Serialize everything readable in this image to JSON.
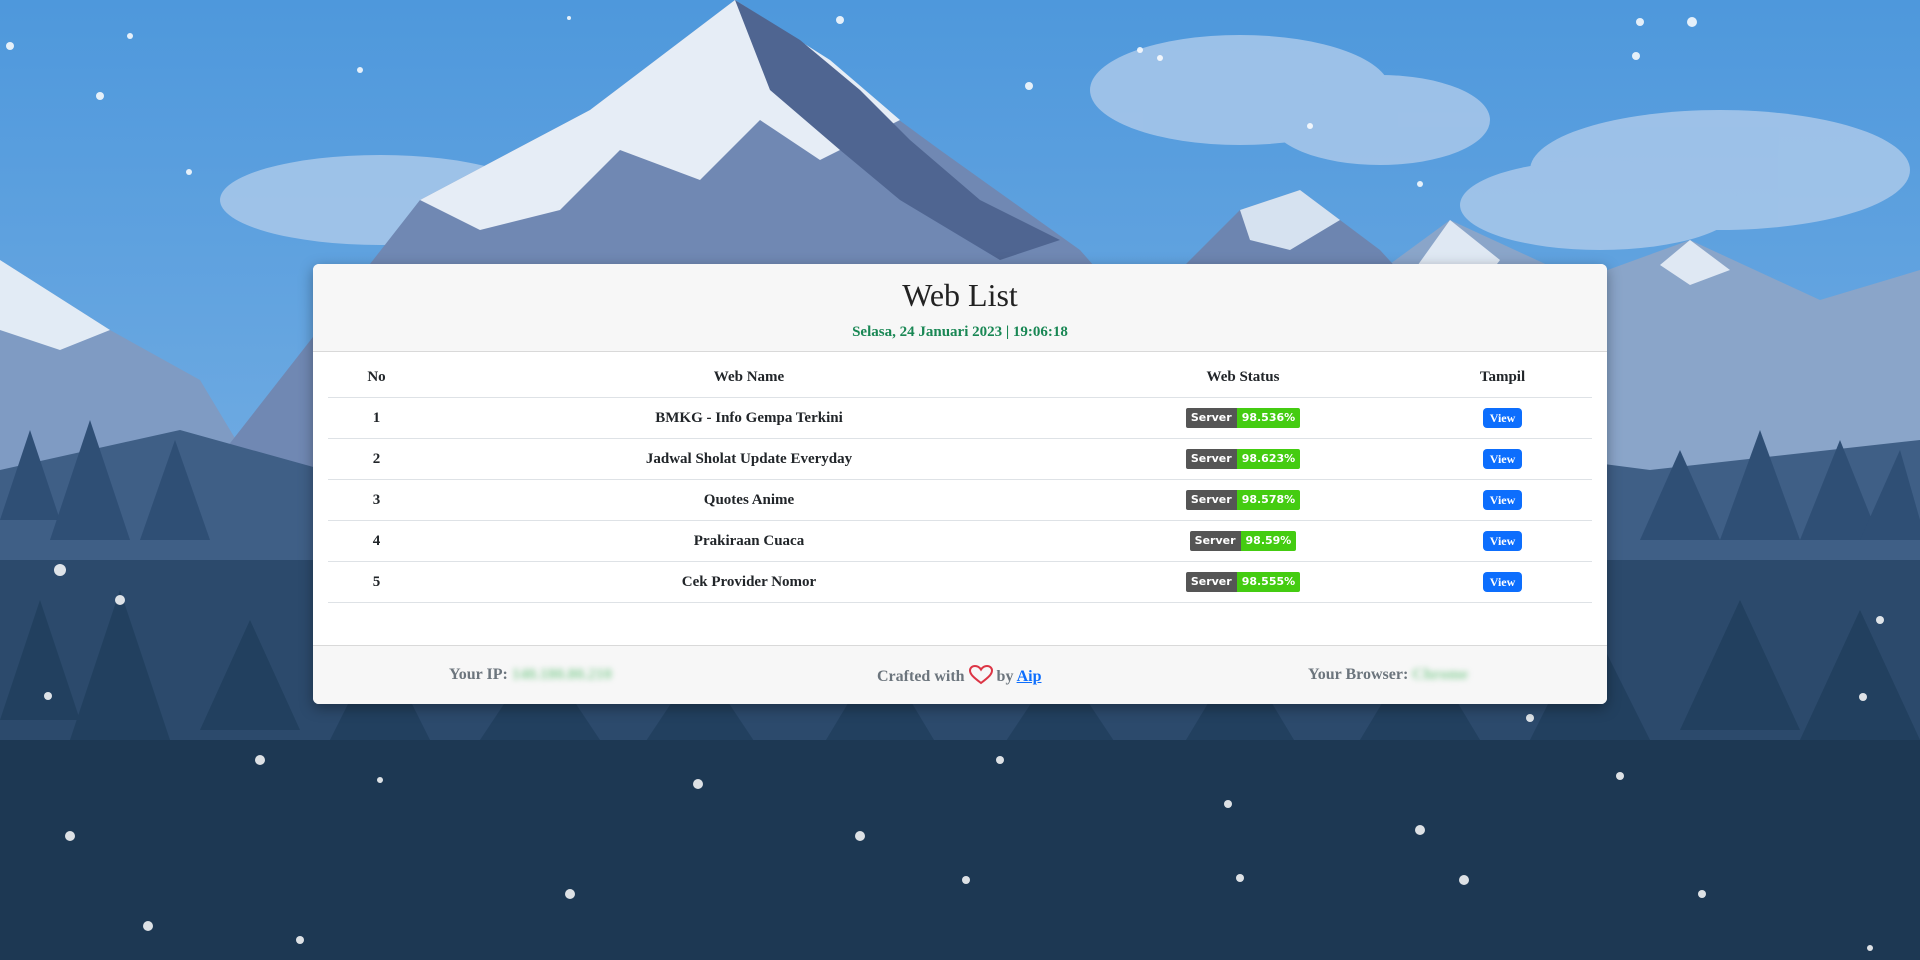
{
  "header": {
    "title": "Web List",
    "datetime": "Selasa, 24 Januari 2023 | 19:06:18"
  },
  "table": {
    "columns": [
      "No",
      "Web Name",
      "Web Status",
      "Tampil"
    ],
    "rows": [
      {
        "no": "1",
        "name": "BMKG - Info Gempa Terkini",
        "status_label": "Server",
        "status_value": "98.536%",
        "action": "View"
      },
      {
        "no": "2",
        "name": "Jadwal Sholat Update Everyday",
        "status_label": "Server",
        "status_value": "98.623%",
        "action": "View"
      },
      {
        "no": "3",
        "name": "Quotes Anime",
        "status_label": "Server",
        "status_value": "98.578%",
        "action": "View"
      },
      {
        "no": "4",
        "name": "Prakiraan Cuaca",
        "status_label": "Server",
        "status_value": "98.59%",
        "action": "View"
      },
      {
        "no": "5",
        "name": "Cek Provider Nomor",
        "status_label": "Server",
        "status_value": "98.555%",
        "action": "View"
      }
    ]
  },
  "footer": {
    "ip_label": "Your IP:",
    "ip_value": "140.180.80.210",
    "credit_prefix": "Crafted with",
    "credit_by": "by",
    "author": "Aip",
    "browser_label": "Your Browser:",
    "browser_value": "Chrome"
  },
  "colors": {
    "accent": "#0d6efd",
    "datetime": "#198754",
    "badge_label": "#555555",
    "badge_value": "#44cc11",
    "heart": "#dc3545"
  },
  "icons": {
    "credit_icon": "heart-outline-icon",
    "background": "snowy-mountain-landscape"
  }
}
